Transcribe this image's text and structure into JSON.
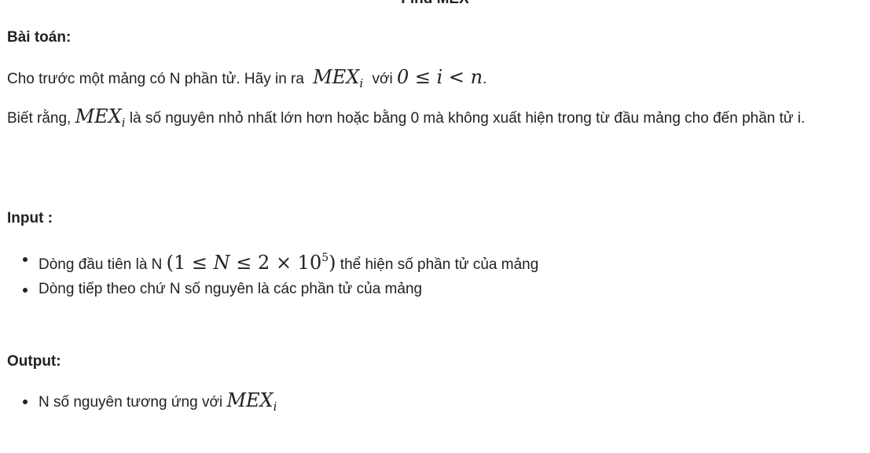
{
  "page": {
    "title": "Find MEX"
  },
  "problem": {
    "heading": "Bài toán:",
    "line1": {
      "pre": "Cho trước một mảng có N phần tử. Hãy in ra",
      "math_mex": "MEX",
      "math_sub": "i",
      "mid": "với",
      "math_cond": "0 ≤ i < n",
      "post": "."
    },
    "line2": {
      "pre": "Biết rằng,",
      "math_mex": "MEX",
      "math_sub": "i",
      "post": "là số nguyên nhỏ nhất lớn hơn hoặc bằng 0 mà không xuất hiện trong từ đầu mảng cho đến phần tử i."
    }
  },
  "input": {
    "heading": "Input :",
    "items": [
      {
        "pre": "Dòng đầu tiên là N",
        "math_open": "(1 ≤ ",
        "math_n": "N",
        "math_mid": " ≤ 2 × 10",
        "math_exp": "5",
        "math_close": ")",
        "post": "thể hiện số phần tử của mảng"
      },
      {
        "text": "Dòng tiếp theo chứ N số nguyên là các phần tử của mảng"
      }
    ]
  },
  "output": {
    "heading": "Output:",
    "items": [
      {
        "pre": "N số nguyên tương ứng với",
        "math_mex": "MEX",
        "math_sub": "i"
      }
    ]
  }
}
